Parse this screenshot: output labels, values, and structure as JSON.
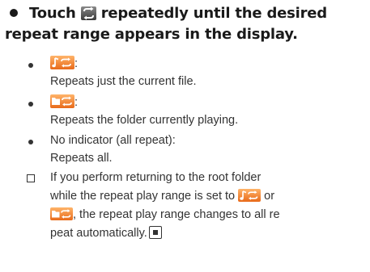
{
  "step": {
    "line1_before_icon": "Touch",
    "line1_after_icon": "repeatedly until the desired",
    "line2": "repeat range appears in the display."
  },
  "icons": {
    "repeat": "repeat-icon",
    "file_repeat": "repeat-file-icon",
    "folder_repeat": "repeat-folder-icon",
    "end": "end-of-section-icon"
  },
  "items": [
    {
      "label_suffix": ":",
      "description": "Repeats just the current file."
    },
    {
      "label_suffix": ":",
      "description": "Repeats the folder currently playing."
    },
    {
      "label": "No indicator (all repeat):",
      "description": "Repeats all."
    }
  ],
  "note": {
    "line1": "If you perform returning to the root folder",
    "line2": "while the repeat play range is set to",
    "line2_or": "or",
    "line3": ", the repeat play range changes to all re",
    "line4": "peat automatically."
  },
  "colors": {
    "icon_orange": "#e86a1a",
    "icon_gray": "#3b3b3b",
    "text": "#333333"
  }
}
